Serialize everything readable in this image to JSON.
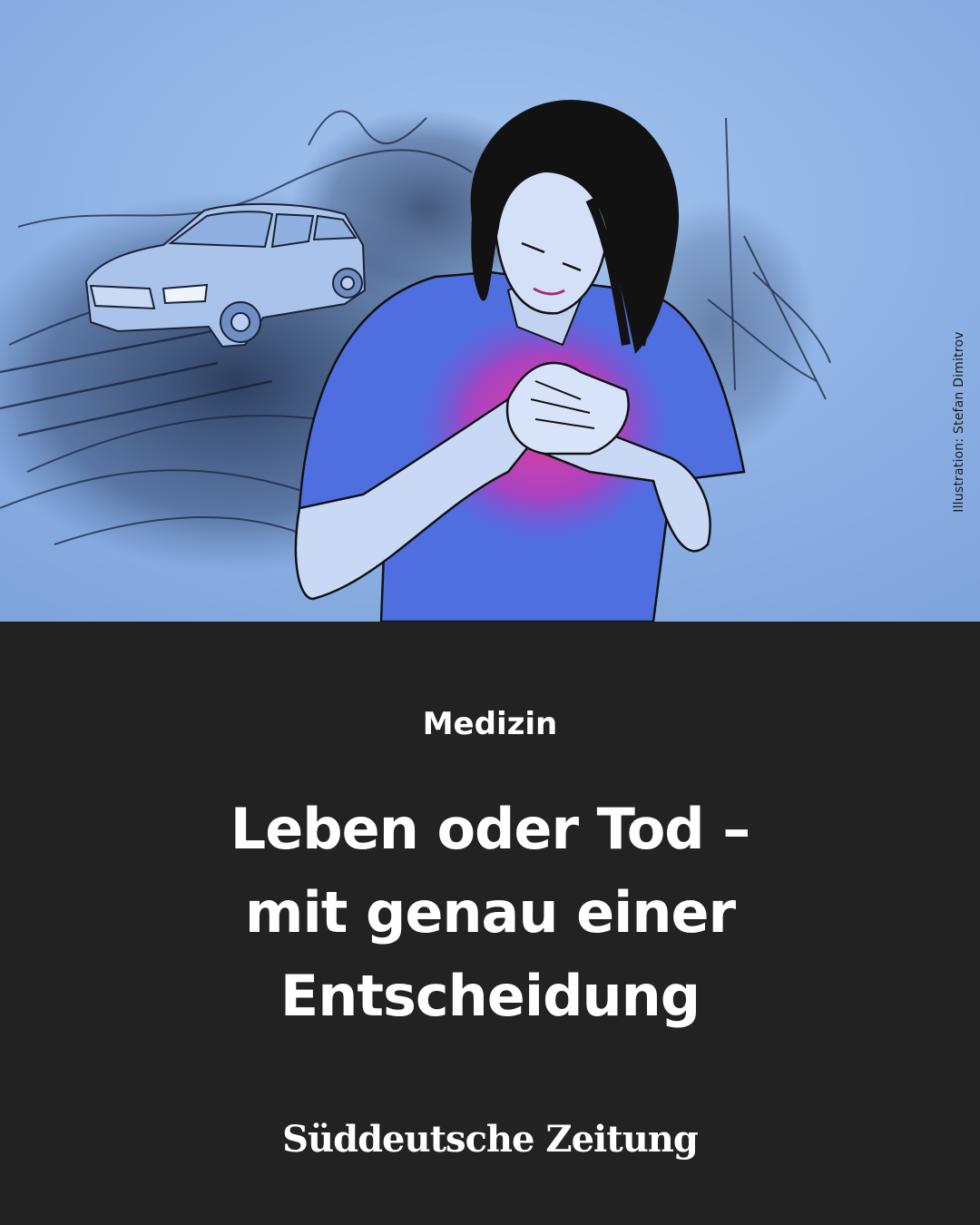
{
  "illustration": {
    "credit": "Illustration: Stefan Dimitrov",
    "colors": {
      "sky": "#8fb4e6",
      "shirt": "#4f6fe0",
      "heart_glow": "#d23ab4",
      "hair": "#111111",
      "smudge": "#1c2c4a"
    },
    "depicts": "person-clutching-chest and car-on-road"
  },
  "category": "Medizin",
  "headline": {
    "line1": "Leben oder Tod –",
    "line2": "mit genau einer",
    "line3": "Entscheidung"
  },
  "brand": {
    "logo": "Süddeutsche Zeitung"
  },
  "colors": {
    "background": "#222222",
    "text": "#ffffff"
  }
}
